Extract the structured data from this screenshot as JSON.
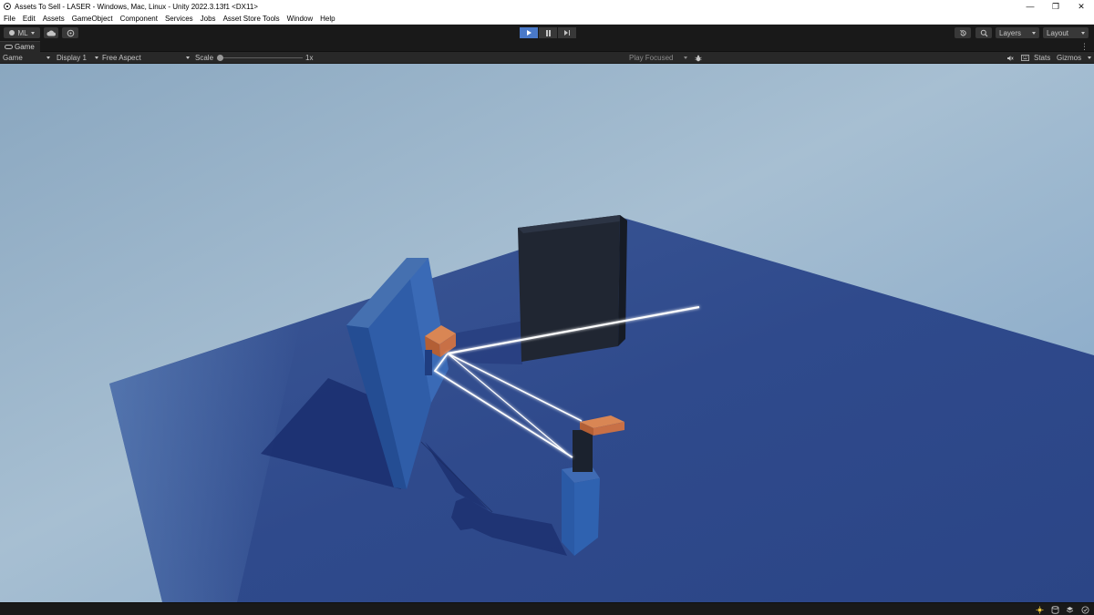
{
  "window": {
    "title": "Assets To Sell - LASER - Windows, Mac, Linux - Unity 2022.3.13f1 <DX11>",
    "controls": {
      "minimize": "—",
      "restore": "❐",
      "close": "✕"
    }
  },
  "menu": {
    "items": [
      "File",
      "Edit",
      "Assets",
      "GameObject",
      "Component",
      "Services",
      "Jobs",
      "Asset Store Tools",
      "Window",
      "Help"
    ]
  },
  "toolbar": {
    "account_label": "ML",
    "layers_label": "Layers",
    "layout_label": "Layout",
    "play_state": "playing"
  },
  "game_tab": {
    "label": "Game"
  },
  "game_controls": {
    "view_mode": "Game",
    "display": "Display 1",
    "aspect": "Free Aspect",
    "scale_label": "Scale",
    "scale_value": "1x",
    "play_mode": "Play Focused",
    "stats_label": "Stats",
    "gizmos_label": "Gizmos"
  },
  "colors": {
    "accent_play": "#4a79c8",
    "sky": "#9fb8cc",
    "floor": "#2f4b8f",
    "laser": "#ffffff",
    "emitter": "#c87046"
  }
}
